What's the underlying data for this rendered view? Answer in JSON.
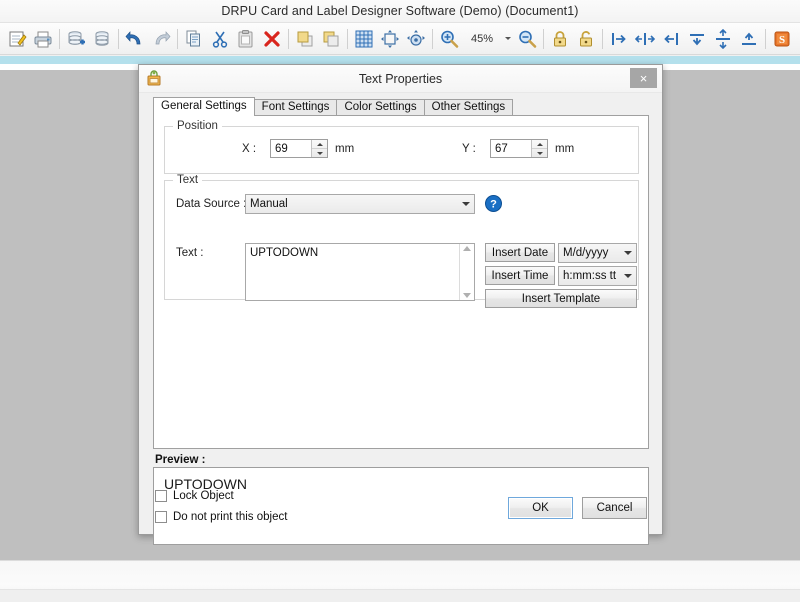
{
  "app": {
    "title": "DRPU Card and Label Designer Software (Demo) (Document1)"
  },
  "toolbar": {
    "zoom_value": "45%",
    "buttons": [
      {
        "name": "new-document-icon",
        "tooltip": "New"
      },
      {
        "name": "print-icon",
        "tooltip": "Print"
      },
      {
        "name": "database-add-icon",
        "tooltip": "Add Database"
      },
      {
        "name": "database-icon",
        "tooltip": "Database"
      },
      {
        "name": "undo-icon",
        "tooltip": "Undo"
      },
      {
        "name": "redo-icon",
        "tooltip": "Redo"
      },
      {
        "name": "copy-icon",
        "tooltip": "Copy"
      },
      {
        "name": "cut-icon",
        "tooltip": "Cut"
      },
      {
        "name": "paste-icon",
        "tooltip": "Paste"
      },
      {
        "name": "delete-icon",
        "tooltip": "Delete"
      },
      {
        "name": "bring-to-front-icon",
        "tooltip": "Bring to Front"
      },
      {
        "name": "send-to-back-icon",
        "tooltip": "Send to Back"
      },
      {
        "name": "grid-icon",
        "tooltip": "Grid"
      },
      {
        "name": "move-object-icon",
        "tooltip": "Move Object"
      },
      {
        "name": "rotate-object-icon",
        "tooltip": "Rotate Object"
      },
      {
        "name": "zoom-in-icon",
        "tooltip": "Zoom In"
      },
      {
        "name": "zoom-out-icon",
        "tooltip": "Zoom Out"
      },
      {
        "name": "lock-icon",
        "tooltip": "Lock"
      },
      {
        "name": "unlock-icon",
        "tooltip": "Unlock"
      },
      {
        "name": "align-left-icon",
        "tooltip": "Align Left"
      },
      {
        "name": "align-center-h-icon",
        "tooltip": "Align Center"
      },
      {
        "name": "align-right-icon",
        "tooltip": "Align Right"
      },
      {
        "name": "align-top-icon",
        "tooltip": "Align Top"
      },
      {
        "name": "align-middle-v-icon",
        "tooltip": "Align Middle"
      },
      {
        "name": "align-bottom-icon",
        "tooltip": "Align Bottom"
      },
      {
        "name": "currency-symbol-icon",
        "tooltip": "Currency"
      }
    ]
  },
  "dialog": {
    "title": "Text Properties",
    "close_label": "×",
    "tabs": [
      {
        "label": "General Settings",
        "active": true
      },
      {
        "label": "Font Settings",
        "active": false
      },
      {
        "label": "Color Settings",
        "active": false
      },
      {
        "label": "Other Settings",
        "active": false
      }
    ],
    "position_group": {
      "legend": "Position",
      "x_label": "X :",
      "x_value": "69",
      "x_unit": "mm",
      "y_label": "Y :",
      "y_value": "67",
      "y_unit": "mm"
    },
    "text_group": {
      "legend": "Text",
      "data_source_label": "Data Source :",
      "data_source_value": "Manual",
      "help_label": "?",
      "text_label": "Text :",
      "text_value": "UPTODOWN",
      "insert_date_label": "Insert Date",
      "date_format_value": "M/d/yyyy",
      "insert_time_label": "Insert Time",
      "time_format_value": "h:mm:ss tt",
      "insert_template_label": "Insert Template"
    },
    "preview": {
      "label": "Preview :",
      "value": "UPTODOWN"
    },
    "footer": {
      "lock_object_label": "Lock Object",
      "lock_object_checked": false,
      "do_not_print_label": "Do not print this object",
      "do_not_print_checked": false,
      "ok_label": "OK",
      "cancel_label": "Cancel"
    }
  }
}
